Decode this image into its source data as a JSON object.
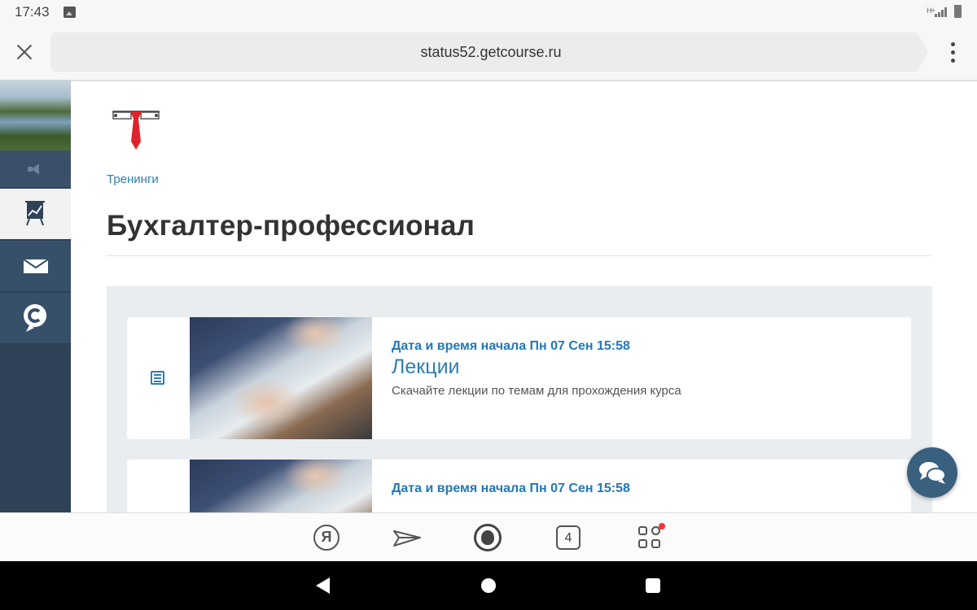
{
  "status_bar": {
    "time": "17:43",
    "signal_label": "H+"
  },
  "browser": {
    "url": "status52.getcourse.ru"
  },
  "sidebar": {
    "items": [
      {
        "name": "speaker",
        "icon": "speaker-icon"
      },
      {
        "name": "trainings",
        "icon": "presentation-chart-icon",
        "active": true
      },
      {
        "name": "messages",
        "icon": "envelope-icon"
      },
      {
        "name": "chat",
        "icon": "chat-c-icon"
      }
    ]
  },
  "content": {
    "breadcrumb": "Тренинги",
    "title": "Бухгалтер-профессионал",
    "lessons": [
      {
        "date": "Дата и время начала Пн 07 Сен 15:58",
        "title": "Лекции",
        "description": "Скачайте лекции по темам для прохождения курса"
      },
      {
        "date": "Дата и время начала Пн 07 Сен 15:58",
        "title": "",
        "description": ""
      }
    ]
  },
  "bottom_bar": {
    "yandex_label": "Я",
    "tabs_count": "4",
    "apps_has_notification": true
  },
  "colors": {
    "sidebar": "#2f4257",
    "link": "#2d7fb2",
    "fab": "#3a607f",
    "panel": "#e9edf0"
  }
}
